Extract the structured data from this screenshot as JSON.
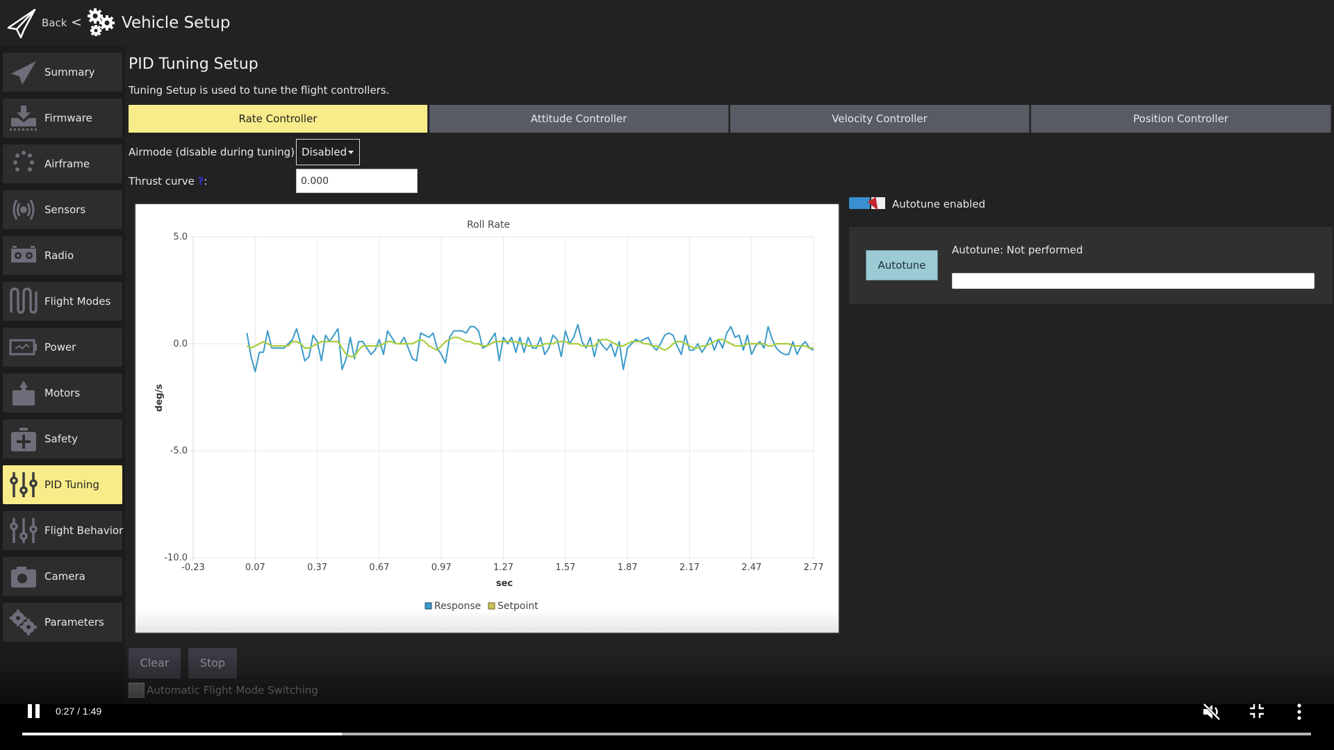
{
  "header": {
    "back_label": "Back",
    "separator": "<",
    "title": "Vehicle Setup",
    "icons": {
      "back": "paper-plane-icon",
      "section": "gears-icon"
    }
  },
  "sidebar": {
    "items": [
      {
        "label": "Summary",
        "icon": "paper-plane-icon",
        "active": false
      },
      {
        "label": "Firmware",
        "icon": "download-icon",
        "active": false
      },
      {
        "label": "Airframe",
        "icon": "airframe-dots-icon",
        "active": false
      },
      {
        "label": "Sensors",
        "icon": "radio-waves-icon",
        "active": false
      },
      {
        "label": "Radio",
        "icon": "radio-transmitter-icon",
        "active": false
      },
      {
        "label": "Flight Modes",
        "icon": "wave-icon",
        "active": false
      },
      {
        "label": "Power",
        "icon": "battery-icon",
        "active": false
      },
      {
        "label": "Motors",
        "icon": "motor-icon",
        "active": false
      },
      {
        "label": "Safety",
        "icon": "first-aid-kit-icon",
        "active": false
      },
      {
        "label": "PID Tuning",
        "icon": "sliders-icon",
        "active": true
      },
      {
        "label": "Flight Behavior",
        "icon": "sliders-icon",
        "active": false
      },
      {
        "label": "Camera",
        "icon": "camera-icon",
        "active": false
      },
      {
        "label": "Parameters",
        "icon": "gears-icon",
        "active": false
      }
    ]
  },
  "main": {
    "title": "PID Tuning Setup",
    "description": "Tuning Setup is used to tune the flight controllers.",
    "tabs": [
      {
        "label": "Rate Controller",
        "active": true
      },
      {
        "label": "Attitude Controller",
        "active": false
      },
      {
        "label": "Velocity Controller",
        "active": false
      },
      {
        "label": "Position Controller",
        "active": false
      }
    ],
    "airmode": {
      "label": "Airmode (disable during tuning)",
      "help": "?",
      "colon": ":",
      "value": "Disabled"
    },
    "thrust_curve": {
      "label": "Thrust curve",
      "help": "?",
      "colon": ":",
      "value": "0.000"
    },
    "buttons": {
      "clear": "Clear",
      "stop": "Stop"
    },
    "auto_switch": {
      "label": "Automatic Flight Mode Switching",
      "checked": false
    }
  },
  "autotune": {
    "toggle_label": "Autotune enabled",
    "toggle_on": true,
    "button_label": "Autotune",
    "status": "Autotune: Not performed",
    "progress": 0
  },
  "colors": {
    "accent_yellow": "#f8ec8a",
    "response": "#3a9ac9",
    "setpoint": "#a8cc3c",
    "toggle_blue": "#3a8fd0",
    "autotune_button": "#9ccbd6"
  },
  "video": {
    "time": "0:27 / 1:49",
    "played_fraction": 0.248,
    "icons": [
      "pause-icon",
      "mute-icon",
      "exit-fullscreen-icon",
      "more-vert-icon"
    ]
  },
  "chart_data": {
    "type": "line",
    "title": "Roll Rate",
    "xlabel": "sec",
    "ylabel": "deg/s",
    "xlim": [
      -0.23,
      2.77
    ],
    "ylim": [
      -10.0,
      5.0
    ],
    "xticks": [
      "-0.23",
      "0.07",
      "0.37",
      "0.67",
      "0.97",
      "1.27",
      "1.57",
      "1.87",
      "2.17",
      "2.47",
      "2.77"
    ],
    "yticks": [
      "5.0",
      "0.0",
      "-5.0",
      "-10.0"
    ],
    "grid": true,
    "legend": "bottom-center",
    "x": [
      0.03,
      0.05,
      0.07,
      0.09,
      0.11,
      0.13,
      0.15,
      0.17,
      0.19,
      0.21,
      0.23,
      0.25,
      0.27,
      0.29,
      0.31,
      0.33,
      0.35,
      0.37,
      0.39,
      0.41,
      0.43,
      0.45,
      0.47,
      0.49,
      0.51,
      0.53,
      0.55,
      0.57,
      0.59,
      0.61,
      0.63,
      0.65,
      0.67,
      0.69,
      0.71,
      0.73,
      0.75,
      0.77,
      0.79,
      0.81,
      0.83,
      0.85,
      0.87,
      0.89,
      0.91,
      0.93,
      0.95,
      0.97,
      0.99,
      1.01,
      1.03,
      1.05,
      1.07,
      1.09,
      1.11,
      1.13,
      1.15,
      1.17,
      1.19,
      1.21,
      1.23,
      1.25,
      1.27,
      1.29,
      1.31,
      1.33,
      1.35,
      1.37,
      1.39,
      1.41,
      1.43,
      1.45,
      1.47,
      1.49,
      1.51,
      1.53,
      1.55,
      1.57,
      1.59,
      1.61,
      1.63,
      1.65,
      1.67,
      1.69,
      1.71,
      1.73,
      1.75,
      1.77,
      1.79,
      1.81,
      1.83,
      1.85,
      1.87,
      1.89,
      1.91,
      1.93,
      1.95,
      1.97,
      1.99,
      2.01,
      2.03,
      2.05,
      2.07,
      2.09,
      2.11,
      2.13,
      2.15,
      2.17,
      2.19,
      2.21,
      2.23,
      2.25,
      2.27,
      2.29,
      2.31,
      2.33,
      2.35,
      2.37,
      2.39,
      2.41,
      2.43,
      2.45,
      2.47,
      2.49,
      2.51,
      2.53,
      2.55,
      2.57,
      2.59,
      2.61,
      2.63,
      2.65,
      2.67,
      2.69,
      2.71,
      2.73,
      2.75,
      2.77
    ],
    "series": [
      {
        "name": "Response",
        "values": [
          0.5,
          -0.6,
          -1.3,
          -0.4,
          -0.4,
          0.6,
          -0.2,
          -0.2,
          -0.2,
          -0.2,
          0.0,
          0.2,
          0.7,
          0.0,
          -0.8,
          -0.6,
          0.4,
          0.1,
          -0.8,
          0.4,
          0.1,
          0.4,
          0.7,
          -1.2,
          -0.7,
          0.3,
          -0.7,
          0.1,
          0.1,
          -0.2,
          -0.5,
          -0.3,
          0.2,
          -0.5,
          0.6,
          0.3,
          0.0,
          0.0,
          0.3,
          -0.2,
          -0.7,
          -0.8,
          0.5,
          0.4,
          0.3,
          0.5,
          -0.2,
          -0.5,
          -0.9,
          0.3,
          0.6,
          0.6,
          0.6,
          0.5,
          0.8,
          0.8,
          0.6,
          -0.2,
          -0.1,
          0.2,
          0.5,
          -0.8,
          0.3,
          0.0,
          0.3,
          -0.4,
          0.3,
          -0.4,
          0.3,
          -0.2,
          -0.2,
          0.3,
          -0.5,
          -0.2,
          0.4,
          0.2,
          -0.6,
          0.6,
          0.0,
          0.3,
          0.9,
          0.1,
          -0.2,
          0.3,
          -0.6,
          0.2,
          -0.1,
          -0.3,
          0.0,
          -0.6,
          0.1,
          -1.2,
          -0.2,
          0.0,
          0.2,
          0.1,
          0.2,
          0.3,
          -0.1,
          -0.3,
          0.0,
          0.4,
          0.5,
          0.4,
          -0.1,
          -0.5,
          0.4,
          -0.3,
          -0.3,
          0.0,
          -0.4,
          -0.1,
          0.3,
          -0.3,
          0.2,
          -0.2,
          0.5,
          0.8,
          0.3,
          0.4,
          -0.3,
          0.4,
          -0.5,
          -0.1,
          0.1,
          -0.2,
          0.8,
          0.2,
          -0.2,
          -0.4,
          -0.5,
          -0.5,
          0.1,
          -0.5,
          -0.1,
          0.1,
          -0.2,
          -0.3
        ]
      },
      {
        "name": "Setpoint",
        "values": [
          -0.1,
          -0.2,
          -0.1,
          0.0,
          0.1,
          0.0,
          -0.1,
          -0.1,
          -0.1,
          -0.1,
          -0.1,
          0.1,
          0.1,
          0.0,
          -0.2,
          -0.2,
          -0.1,
          0.0,
          0.1,
          0.1,
          0.1,
          0.1,
          0.1,
          -0.2,
          -0.5,
          -0.6,
          -0.6,
          -0.3,
          -0.1,
          -0.1,
          -0.1,
          -0.1,
          -0.1,
          0.0,
          0.1,
          0.1,
          0.0,
          0.0,
          0.0,
          0.0,
          0.0,
          0.1,
          0.2,
          0.1,
          -0.1,
          -0.2,
          -0.3,
          -0.1,
          0.1,
          0.2,
          0.3,
          0.3,
          0.2,
          0.1,
          0.1,
          0.0,
          0.0,
          -0.1,
          -0.1,
          0.0,
          0.1,
          0.1,
          0.1,
          0.1,
          0.1,
          0.1,
          0.0,
          0.0,
          -0.1,
          -0.1,
          -0.1,
          -0.1,
          0.0,
          0.0,
          0.0,
          0.1,
          0.1,
          0.1,
          0.0,
          0.0,
          0.0,
          -0.1,
          -0.1,
          -0.1,
          -0.1,
          0.1,
          0.2,
          0.2,
          0.1,
          0.0,
          -0.1,
          -0.1,
          0.0,
          0.1,
          0.1,
          0.1,
          0.0,
          0.0,
          -0.1,
          -0.1,
          -0.2,
          -0.3,
          -0.2,
          0.0,
          0.1,
          0.1,
          0.0,
          -0.1,
          -0.2,
          -0.2,
          -0.1,
          -0.1,
          0.0,
          0.1,
          0.2,
          0.2,
          0.1,
          0.0,
          -0.1,
          -0.1,
          -0.1,
          0.0,
          0.0,
          0.0,
          0.0,
          0.0,
          -0.1,
          -0.1,
          0.0,
          0.0,
          0.0,
          0.0,
          -0.1,
          -0.1,
          -0.1,
          -0.1,
          -0.2,
          -0.2
        ]
      }
    ]
  }
}
